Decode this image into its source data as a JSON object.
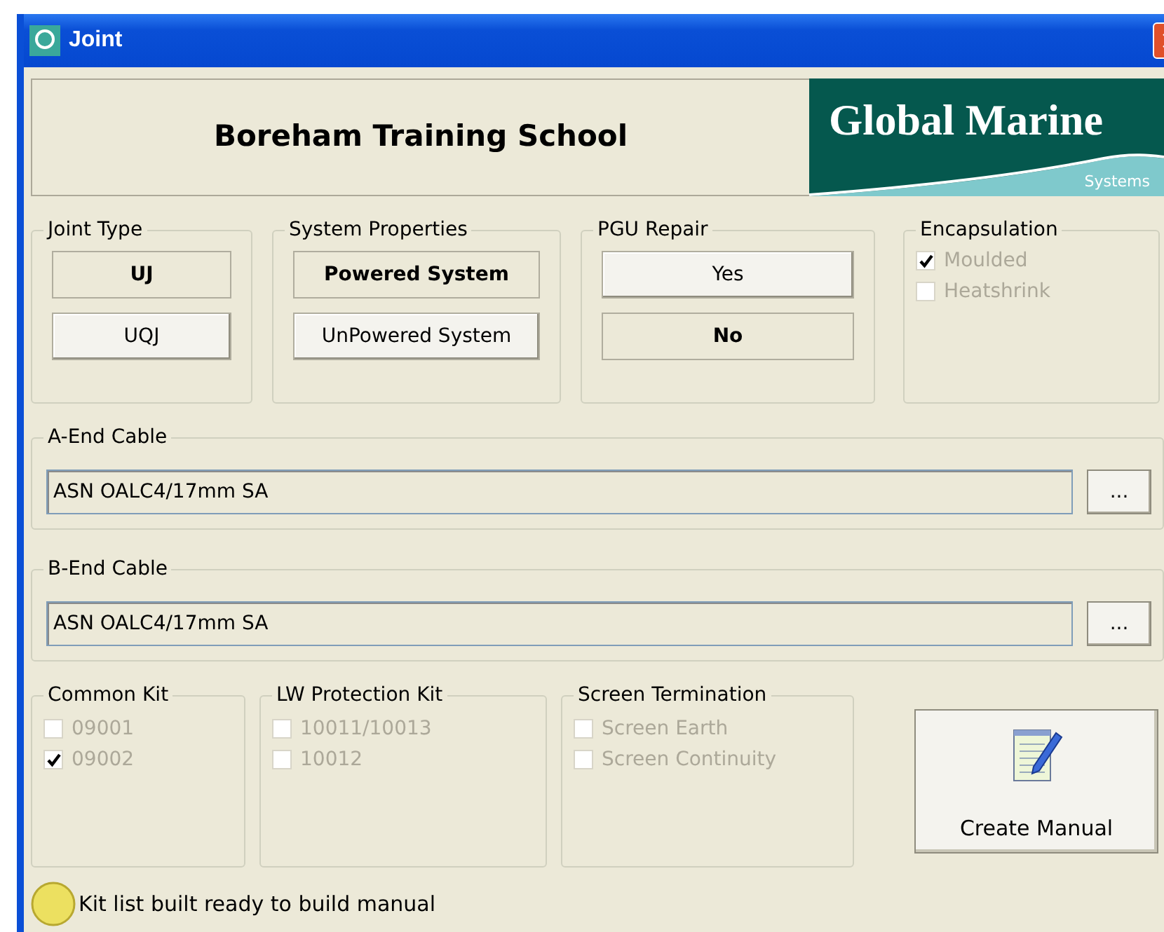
{
  "window": {
    "title": "Joint"
  },
  "header": {
    "school": "Boreham Training School",
    "logo": {
      "name": "Global Marine",
      "tagline": "Systems"
    }
  },
  "option_groups": [
    {
      "title": "Joint Type",
      "buttons": [
        {
          "label": "UJ",
          "selected": true
        },
        {
          "label": "UQJ",
          "selected": false
        }
      ]
    },
    {
      "title": "System Properties",
      "buttons": [
        {
          "label": "Powered System",
          "selected": true
        },
        {
          "label": "UnPowered System",
          "selected": false
        }
      ]
    },
    {
      "title": "PGU Repair",
      "buttons": [
        {
          "label": "Yes",
          "selected": false
        },
        {
          "label": "No",
          "selected": true
        }
      ]
    }
  ],
  "encapsulation": {
    "title": "Encapsulation",
    "options": [
      {
        "label": "Moulded",
        "checked": true,
        "disabled": true
      },
      {
        "label": "Heatshrink",
        "checked": false,
        "disabled": true
      }
    ]
  },
  "cables": [
    {
      "title": "A-End Cable",
      "value": "ASN OALC4/17mm SA",
      "browse": "..."
    },
    {
      "title": "B-End Cable",
      "value": "ASN OALC4/17mm SA",
      "browse": "..."
    }
  ],
  "kits": [
    {
      "title": "Common Kit",
      "options": [
        {
          "label": "09001",
          "checked": false,
          "disabled": true
        },
        {
          "label": "09002",
          "checked": true,
          "disabled": true
        }
      ]
    },
    {
      "title": "LW Protection Kit",
      "options": [
        {
          "label": "10011/10013",
          "checked": false,
          "disabled": true
        },
        {
          "label": "10012",
          "checked": false,
          "disabled": true
        }
      ]
    },
    {
      "title": "Screen Termination",
      "options": [
        {
          "label": "Screen Earth",
          "checked": false,
          "disabled": true
        },
        {
          "label": "Screen Continuity",
          "checked": false,
          "disabled": true
        }
      ]
    }
  ],
  "create_button": {
    "label": "Create Manual"
  },
  "status": {
    "message": "Kit list built ready to build manual"
  }
}
